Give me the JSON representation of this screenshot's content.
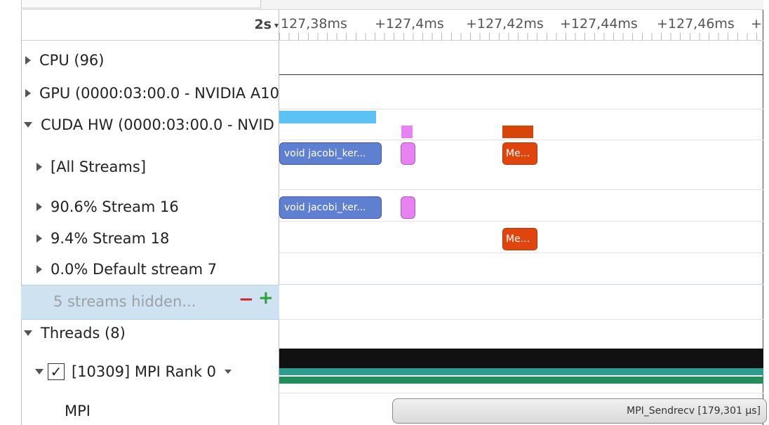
{
  "ruler": {
    "zoom": "2s",
    "ticks": [
      "127,38ms",
      "+127,4ms",
      "+127,42ms",
      "+127,44ms",
      "+127,46ms",
      "+"
    ]
  },
  "rows": {
    "cpu": "CPU (96)",
    "gpu": "GPU (0000:03:00.0 - NVIDIA A10",
    "cuda_hw": "CUDA HW (0000:03:00.0 - NVID",
    "all_streams": "[All Streams]",
    "stream16": "90.6% Stream 16",
    "stream18": "9.4% Stream 18",
    "default_stream": "0.0% Default stream 7",
    "hidden_streams": "5 streams hidden...",
    "threads": "Threads (8)",
    "mpi_rank": "[10309] MPI Rank 0",
    "mpi": "MPI"
  },
  "controls": {
    "minus": "−",
    "plus": "+",
    "check": "✓"
  },
  "timeline": {
    "kernel_label": "void jacobi_ker...",
    "memcpy_label": "Me...",
    "mpi_label": "MPI_Sendrecv [179,301 µs]"
  },
  "colors": {
    "kernel": "#5f7fd0",
    "kernel_overview": "#5cc2f5",
    "memcpy": "#e0450d",
    "memset": "#e882f2",
    "thread_active": "#111111",
    "thread_green": "#1f8f5c",
    "selection": "#cfe2f1"
  },
  "icons": {
    "expand": "triangle-right-icon",
    "collapse": "triangle-down-icon",
    "dropdown": "chevron-down-icon"
  }
}
